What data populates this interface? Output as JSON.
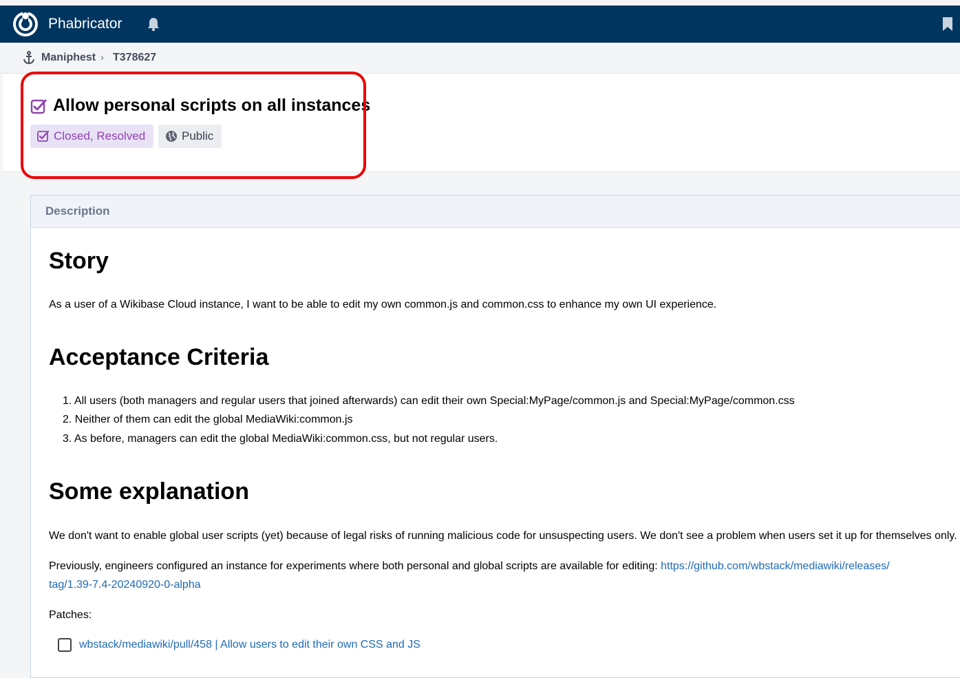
{
  "topbar": {
    "app_name": "Phabricator",
    "logo_icon": "wikimedia-logo-icon",
    "bell_icon": "bell-icon",
    "bookmark_icon": "bookmark-icon"
  },
  "breadcrumb": {
    "icon": "anchor-icon",
    "items": [
      "Maniphest",
      "T378627"
    ],
    "separator": "›"
  },
  "task": {
    "title": "Allow personal scripts on all instances",
    "status": "Closed, Resolved",
    "visibility": "Public",
    "status_color": "#8e44ad"
  },
  "description": {
    "header": "Description",
    "story_heading": "Story",
    "story_text": "As a user of a Wikibase Cloud instance, I want to be able to edit my own common.js and common.css to enhance my own UI experience.",
    "criteria_heading": "Acceptance Criteria",
    "criteria": [
      "1. All users (both managers and regular users that joined afterwards) can edit their own Special:MyPage/common.js and Special:MyPage/common.css",
      "2. Neither of them can edit the global MediaWiki:common.js",
      "3. As before, managers can edit the global MediaWiki:common.css, but not regular users."
    ],
    "explanation_heading": "Some explanation",
    "explanation_p1": "We don't want to enable global user scripts (yet) because of legal risks of running malicious code for unsuspecting users. We don't see a problem when users set it up for themselves only.",
    "explanation_p2_prefix": "Previously, engineers configured an instance for experiments where both personal and global scripts are available for editing: ",
    "explanation_p2_link_line1": "https://github.com/wbstack/mediawiki/releases/",
    "explanation_p2_link_line2": "tag/1.39-7.4-20240920-0-alpha",
    "patches_label": "Patches:",
    "patch_link": "wbstack/mediawiki/pull/458 | Allow users to edit their own CSS and JS"
  }
}
